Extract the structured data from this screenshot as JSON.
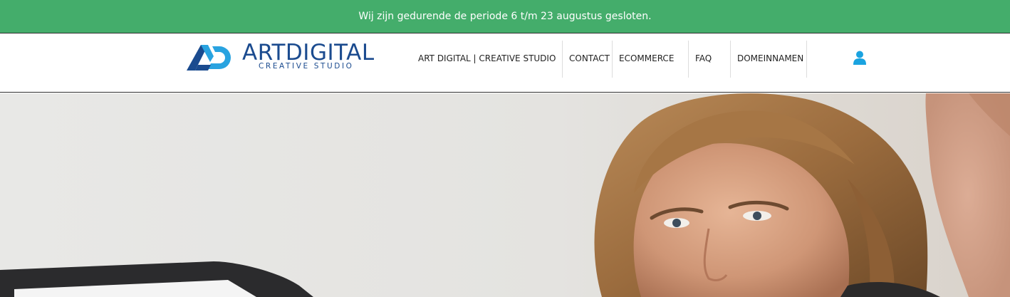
{
  "notice": {
    "text": "Wij zijn gedurende de periode 6 t/m 23 augustus gesloten.",
    "bg_color": "#44ad6b"
  },
  "logo": {
    "title": "ARTDIGITAL",
    "subtitle": "CREATIVE STUDIO",
    "primary_color": "#1b4b8f",
    "accent_color": "#29a3e0"
  },
  "nav": {
    "items": [
      {
        "label": "ART DIGITAL | CREATIVE STUDIO"
      },
      {
        "label": "CONTACT"
      },
      {
        "label": "ECOMMERCE"
      },
      {
        "label": "FAQ"
      },
      {
        "label": "DOMEINNAMEN"
      }
    ]
  },
  "account": {
    "icon": "user-icon",
    "color": "#1aa3e0"
  },
  "hero": {
    "image": "woman-at-laptop-photo"
  }
}
